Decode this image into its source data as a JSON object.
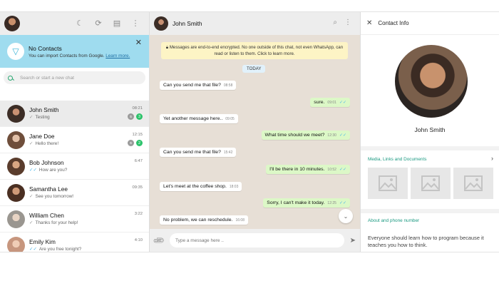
{
  "sidebar": {
    "banner": {
      "title": "No Contacts",
      "subtitle": "You can import Contacts from Google.",
      "link": "Learn more."
    },
    "search_placeholder": "Search or start a new chat",
    "chats": [
      {
        "name": "John Smith",
        "last": "Testing",
        "time": "08:21",
        "muted": true,
        "unread": "3",
        "tick": "grey",
        "color": "#4e4e4e"
      },
      {
        "name": "Jane Doe",
        "last": "Hello there!",
        "time": "12:15",
        "muted": true,
        "unread": "2",
        "tick": "grey",
        "color": "#b58b7a"
      },
      {
        "name": "Bob Johnson",
        "last": "How are you?",
        "time": "6:47",
        "muted": false,
        "unread": "",
        "tick": "blue",
        "color": "#8b6e5b"
      },
      {
        "name": "Samantha Lee",
        "last": "See you tomorrow!",
        "time": "09:35",
        "muted": false,
        "unread": "",
        "tick": "grey",
        "color": "#7b5c4a"
      },
      {
        "name": "William Chen",
        "last": "Thanks for your help!",
        "time": "3:22",
        "muted": false,
        "unread": "",
        "tick": "grey",
        "color": "#a09a92"
      },
      {
        "name": "Emily Kim",
        "last": "Are you free tonight?",
        "time": "4:10",
        "muted": false,
        "unread": "",
        "tick": "blue",
        "color": "#c79b85"
      }
    ]
  },
  "chat": {
    "contact_name": "John Smith",
    "encryption_notice": "Messages are end-to-end encrypted. No one outside of this chat, not even WhatsApp, can read or listen to them. Click to learn more.",
    "date_label": "TODAY",
    "messages": [
      {
        "dir": "in",
        "text": "Can you send me that file?",
        "time": "08:58"
      },
      {
        "dir": "out",
        "text": "sure.",
        "time": "09:01"
      },
      {
        "dir": "in",
        "text": "Yet another message here..",
        "time": "09:05"
      },
      {
        "dir": "out",
        "text": "What time should we meet?",
        "time": "12:30"
      },
      {
        "dir": "in",
        "text": "Can you send me that file?",
        "time": "15:42"
      },
      {
        "dir": "out",
        "text": "I'll be there in 10 minutes.",
        "time": "10:52"
      },
      {
        "dir": "in",
        "text": "Let's meet at the coffee shop.",
        "time": "18:03"
      },
      {
        "dir": "out",
        "text": "Sorry, I can't make it today.",
        "time": "12:25"
      },
      {
        "dir": "in",
        "text": "No problem, we can reschedule.",
        "time": "16:08"
      }
    ],
    "composer_placeholder": "Type a message here .."
  },
  "contact_info": {
    "title": "Contact Info",
    "name": "John Smith",
    "media_title": "Media, Links and Documents",
    "about_title": "About and phone number",
    "about_text": "Everyone should learn how to program because it teaches you how to think."
  },
  "colors": {
    "accent": "#1c9a82",
    "banner_bg": "#9fdcef",
    "outgoing_bubble": "#dcf8c7",
    "chat_bg": "#e7dfd6"
  }
}
